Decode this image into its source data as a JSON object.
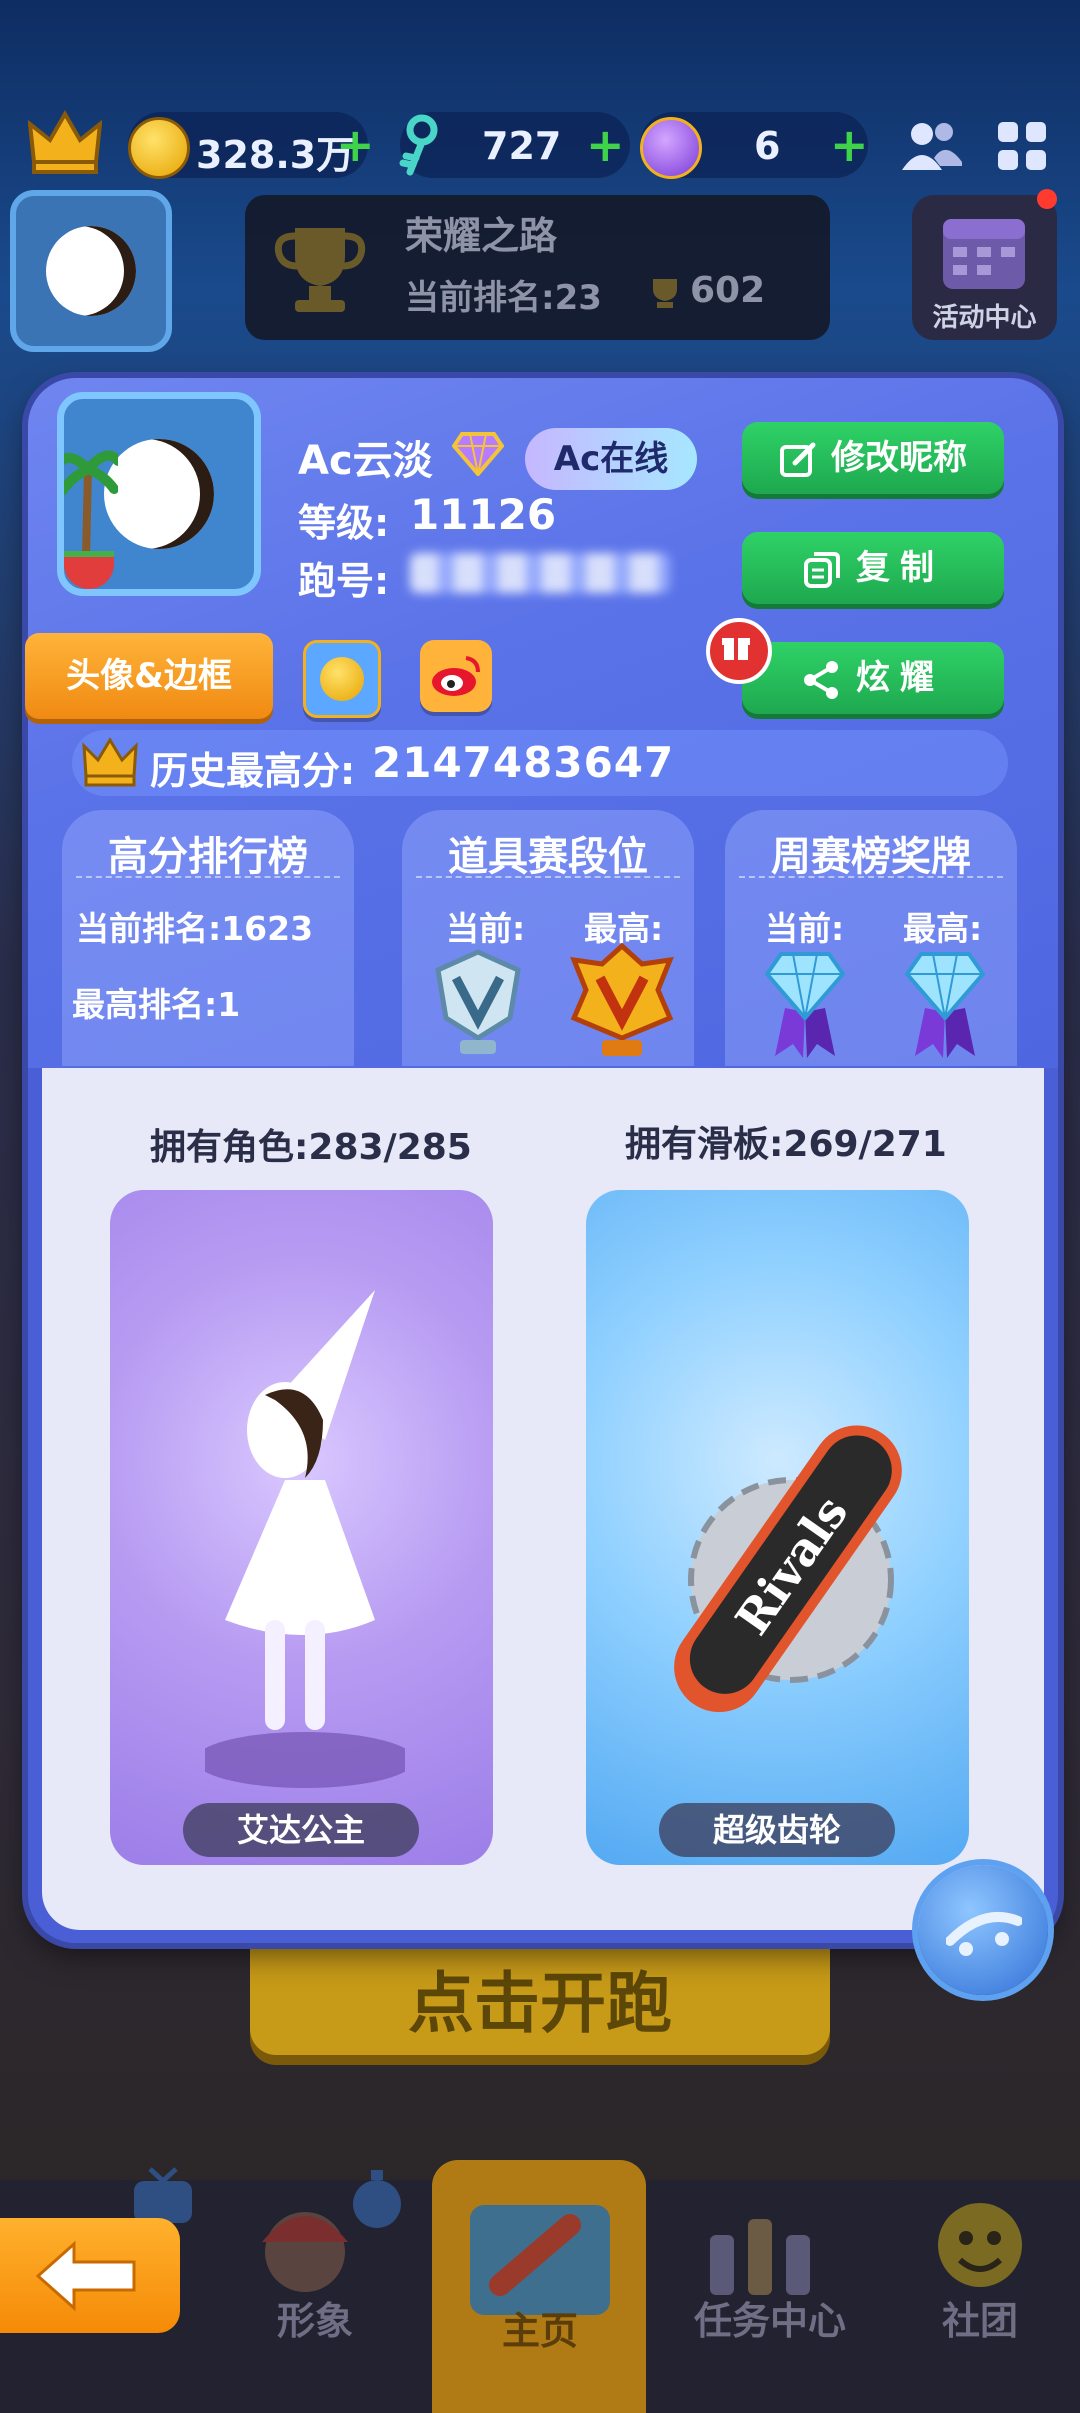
{
  "top_bar": {
    "coins": "328.3万",
    "keys": "727",
    "tokens": "6",
    "plus": "+"
  },
  "header": {
    "glory_title": "荣耀之路",
    "glory_rank": "当前排名:23",
    "glory_trophies": "602",
    "activity_label": "活动中心"
  },
  "profile": {
    "nickname": "Ac云淡",
    "online_badge": "Ac在线",
    "level_label": "等级:",
    "level_value": "11126",
    "id_label": "跑号:",
    "buttons": {
      "edit_nickname": "修改昵称",
      "copy": "复制",
      "share": "炫耀",
      "avatar_frame": "头像&边框"
    },
    "high_score_label": "历史最高分:",
    "high_score_value": "2147483647"
  },
  "panels": {
    "highscore": {
      "title": "高分排行榜",
      "current_rank": "当前排名:1623",
      "best_rank": "最高排名:1"
    },
    "item_race": {
      "title": "道具赛段位",
      "current": "当前:",
      "best": "最高:"
    },
    "weekly": {
      "title": "周赛榜奖牌",
      "current": "当前:",
      "best": "最高:"
    }
  },
  "collection": {
    "characters_owned": "拥有角色:283/285",
    "boards_owned": "拥有滑板:269/271",
    "character_name": "艾达公主",
    "board_name": "超级齿轮",
    "board_logo": "Rivals"
  },
  "background": {
    "start_button": "点击开跑"
  },
  "nav": {
    "back_label": "",
    "tabs": [
      "形象",
      "主页",
      "任务中心",
      "社团"
    ]
  },
  "colors": {
    "accent_green": "#2fd267",
    "accent_orange": "#f59a1f",
    "modal_blue": "#5b73e8",
    "card_purple": "#b79bf2",
    "card_blue": "#8fd0ff"
  }
}
